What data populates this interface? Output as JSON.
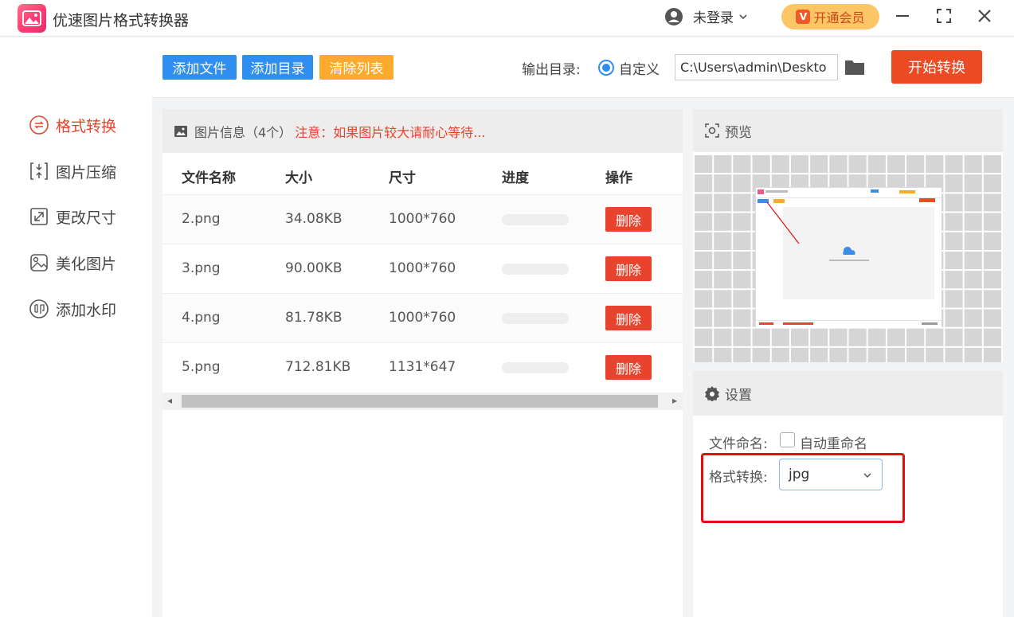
{
  "window": {
    "title": "优速图片格式转换器",
    "user_label": "未登录",
    "vip_label": "开通会员",
    "vip_icon_letter": "V"
  },
  "sidebar": {
    "items": [
      {
        "label": "格式转换",
        "icon": "format-convert-icon",
        "active": true
      },
      {
        "label": "图片压缩",
        "icon": "compress-icon",
        "active": false
      },
      {
        "label": "更改尺寸",
        "icon": "resize-icon",
        "active": false
      },
      {
        "label": "美化图片",
        "icon": "beautify-icon",
        "active": false
      },
      {
        "label": "添加水印",
        "icon": "watermark-icon",
        "active": false
      }
    ]
  },
  "toolbar": {
    "add_file": "添加文件",
    "add_dir": "添加目录",
    "clear_list": "清除列表",
    "output_label": "输出目录:",
    "custom_label": "自定义",
    "output_path": "C:\\Users\\admin\\Deskto",
    "start_label": "开始转换"
  },
  "file_panel": {
    "title": "图片信息（4个）",
    "note": "注意：如果图片较大请耐心等待...",
    "columns": [
      "文件名称",
      "大小",
      "尺寸",
      "进度",
      "操作"
    ],
    "rows": [
      {
        "name": "2.png",
        "size": "34.08KB",
        "dims": "1000*760",
        "progress": 0,
        "action": "删除"
      },
      {
        "name": "3.png",
        "size": "90.00KB",
        "dims": "1000*760",
        "progress": 0,
        "action": "删除"
      },
      {
        "name": "4.png",
        "size": "81.78KB",
        "dims": "1000*760",
        "progress": 0,
        "action": "删除"
      },
      {
        "name": "5.png",
        "size": "712.81KB",
        "dims": "1131*647",
        "progress": 0,
        "action": "删除"
      }
    ]
  },
  "preview": {
    "title": "预览"
  },
  "settings": {
    "title": "设置",
    "naming_label": "文件命名:",
    "auto_rename_label": "自动重命名",
    "auto_rename_checked": false,
    "format_label": "格式转换:",
    "format_value": "jpg"
  },
  "colors": {
    "accent_red": "#e8442d",
    "accent_blue": "#2f8ef0",
    "accent_orange": "#fbaa2d",
    "highlight": "#e01010"
  }
}
